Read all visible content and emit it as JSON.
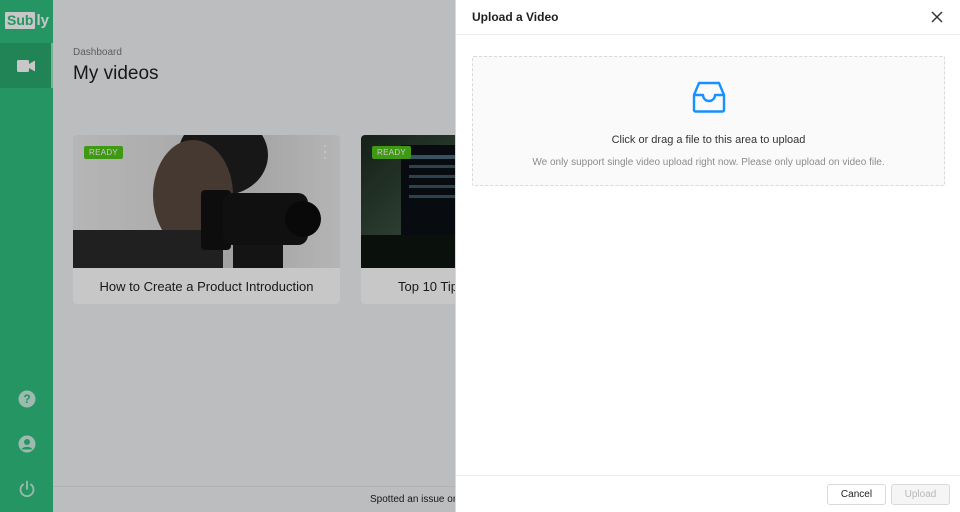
{
  "app": {
    "logo_box": "Sub",
    "logo_rest": "ly",
    "accent": "#2fbf7f"
  },
  "sidebar": {
    "items": [
      {
        "icon": "video-camera-icon",
        "active": true
      },
      {
        "icon": "help-icon"
      },
      {
        "icon": "user-icon"
      },
      {
        "icon": "power-icon"
      }
    ]
  },
  "main": {
    "breadcrumb": "Dashboard",
    "title": "My videos",
    "videos": [
      {
        "status": "READY",
        "title": "How to Create a Product Introduction"
      },
      {
        "status": "READY",
        "title": "Top 10 Tip"
      }
    ],
    "footer_text": "Spotted an issue or r"
  },
  "drawer": {
    "title": "Upload a Video",
    "dropzone_text": "Click or drag a file to this area to upload",
    "dropzone_hint": "We only support single video upload right now. Please only upload on video file.",
    "cancel_label": "Cancel",
    "upload_label": "Upload",
    "icon_color": "#1890ff"
  }
}
